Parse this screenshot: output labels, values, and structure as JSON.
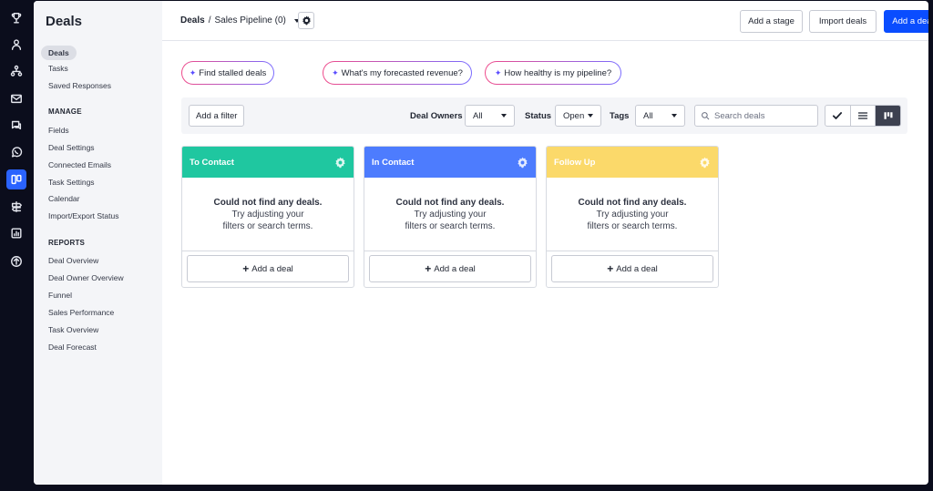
{
  "sidenav": {
    "title": "Deals",
    "items_top": [
      {
        "label": "Deals",
        "active": true
      },
      {
        "label": "Tasks"
      },
      {
        "label": "Saved Responses"
      }
    ],
    "manage_heading": "MANAGE",
    "manage_items": [
      "Fields",
      "Deal Settings",
      "Connected Emails",
      "Task Settings",
      "Calendar",
      "Import/Export Status"
    ],
    "reports_heading": "REPORTS",
    "reports_items": [
      "Deal Overview",
      "Deal Owner Overview",
      "Funnel",
      "Sales Performance",
      "Task Overview",
      "Deal Forecast"
    ]
  },
  "rail_icons": [
    "trophy-icon",
    "contact-icon",
    "org-chart-icon",
    "mail-icon",
    "conversation-icon",
    "whatsapp-icon",
    "pipeline-icon",
    "signpost-icon",
    "reports-icon",
    "upgrade-icon"
  ],
  "header": {
    "crumb_root": "Deals",
    "crumb_sep": "/",
    "pipeline_name": "Sales Pipeline (0)",
    "add_stage": "Add a stage",
    "import_deals": "Import deals",
    "add_deal": "Add a deal"
  },
  "ai_prompts": [
    "Find stalled deals",
    "What's my forecasted revenue?",
    "How healthy is my pipeline?"
  ],
  "filters": {
    "add_filter": "Add a filter",
    "owners_label": "Deal Owners",
    "owners_value": "All",
    "status_label": "Status",
    "status_value": "Open",
    "tags_label": "Tags",
    "tags_value": "All",
    "search_placeholder": "Search deals"
  },
  "columns": [
    {
      "title": "To Contact",
      "color": "#1fc7a0"
    },
    {
      "title": "In Contact",
      "color": "#4d7cfe"
    },
    {
      "title": "Follow Up",
      "color": "#fbd96a"
    }
  ],
  "empty_state": {
    "line1": "Could not find any deals.",
    "line2": "Try adjusting your",
    "line3": "filters or search terms."
  },
  "add_deal_label": "Add a deal",
  "colors": {
    "primary": "#0a4dff",
    "rail_active": "#2a63ff"
  }
}
